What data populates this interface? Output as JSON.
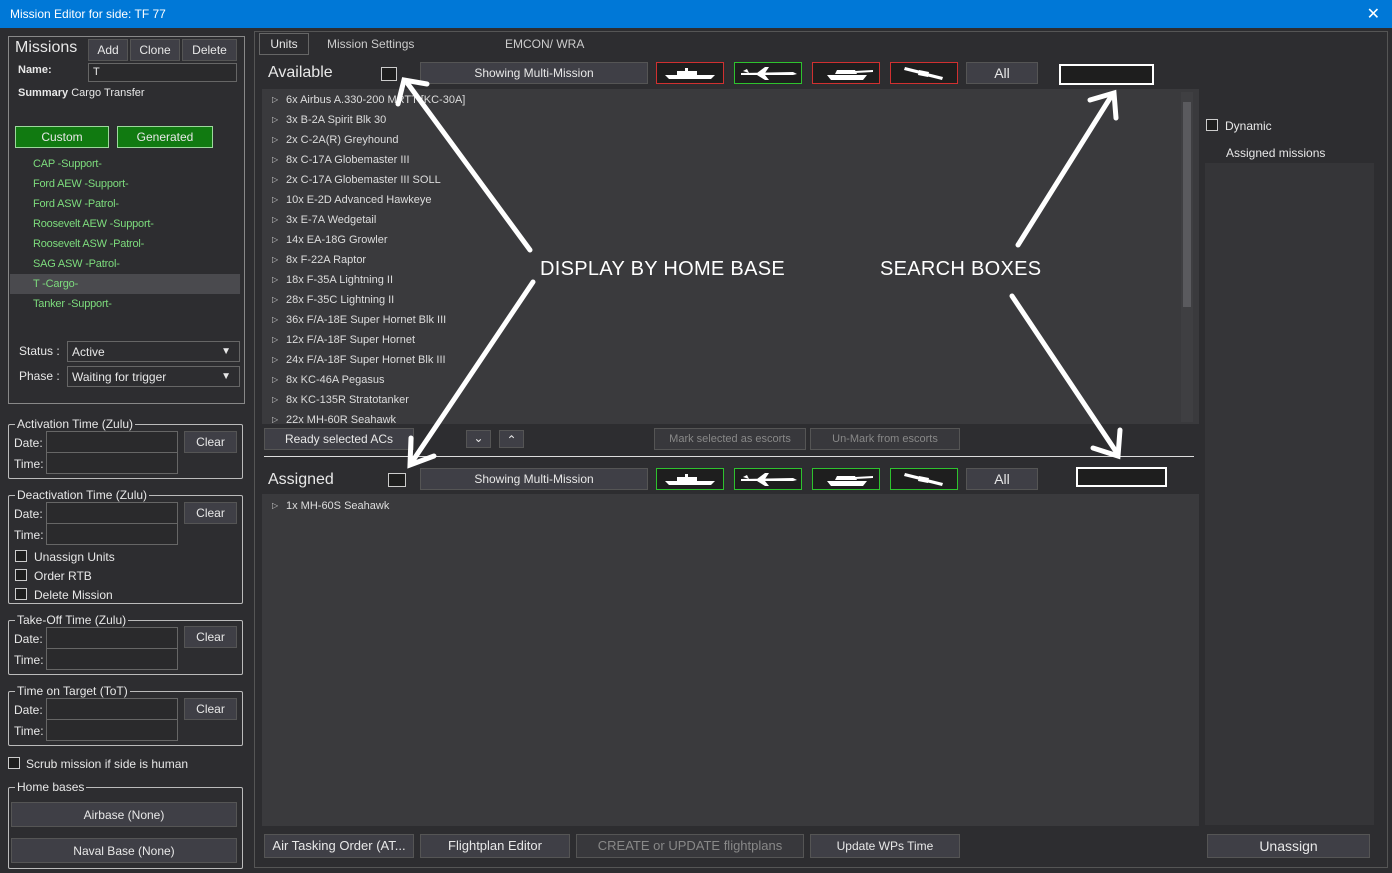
{
  "window": {
    "title": "Mission Editor for side: TF 77",
    "close": "✕"
  },
  "missions": {
    "heading": "Missions",
    "add": "Add",
    "clone": "Clone",
    "delete": "Delete",
    "name_label": "Name:",
    "name_value": "T",
    "summary_label": "Summary",
    "summary_value": "Cargo Transfer",
    "custom": "Custom",
    "generated": "Generated",
    "items": [
      "CAP -Support-",
      "Ford AEW -Support-",
      "Ford ASW  -Patrol-",
      "Roosevelt AEW -Support-",
      "Roosevelt ASW -Patrol-",
      "SAG ASW  -Patrol-",
      "T -Cargo-",
      "Tanker -Support-"
    ],
    "selected_index": 6,
    "status_label": "Status :",
    "status_value": "Active",
    "phase_label": "Phase :",
    "phase_value": "Waiting for trigger"
  },
  "times": {
    "activation": "Activation Time (Zulu)",
    "deactivation": "Deactivation Time (Zulu)",
    "takeoff": "Take-Off Time (Zulu)",
    "tot": "Time on Target (ToT)",
    "date": "Date:",
    "time": "Time:",
    "clear": "Clear",
    "unassign_units": "Unassign Units",
    "order_rtb": "Order RTB",
    "delete_mission": "Delete Mission"
  },
  "scrub": "Scrub mission if side is human",
  "home_bases": {
    "legend": "Home bases",
    "airbase": "Airbase (None)",
    "naval": "Naval Base (None)"
  },
  "tabs": [
    "Units",
    "Mission Settings",
    "EMCON/ WRA"
  ],
  "available": {
    "label": "Available",
    "showing": "Showing Multi-Mission",
    "all": "All",
    "units": [
      "6x Airbus A.330-200 MRTT [KC-30A]",
      "3x B-2A Spirit Blk 30",
      "2x C-2A(R) Greyhound",
      "8x C-17A Globemaster III",
      "2x C-17A Globemaster III SOLL",
      "10x E-2D Advanced Hawkeye",
      "3x E-7A Wedgetail",
      "14x EA-18G Growler",
      "8x F-22A Raptor",
      "18x F-35A Lightning II",
      "28x F-35C Lightning II",
      "36x F/A-18E Super Hornet Blk III",
      "12x F/A-18F Super Hornet",
      "24x F/A-18F Super Hornet Blk III",
      "8x KC-46A Pegasus",
      "8x KC-135R Stratotanker",
      "22x MH-60R Seahawk"
    ]
  },
  "middle": {
    "ready": "Ready selected ACs",
    "mark": "Mark selected as escorts",
    "unmark": "Un-Mark from escorts"
  },
  "assigned": {
    "label": "Assigned",
    "showing": "Showing Multi-Mission",
    "all": "All",
    "units": [
      "1x MH-60S Seahawk"
    ]
  },
  "bottom": {
    "ato": "Air Tasking Order (AT...",
    "flightplan": "Flightplan Editor",
    "create": "CREATE or UPDATE flightplans",
    "update_wps": "Update WPs Time"
  },
  "right": {
    "dynamic": "Dynamic",
    "assigned_missions": "Assigned missions",
    "unassign": "Unassign"
  },
  "annotations": {
    "home_base": "DISPLAY BY HOME BASE",
    "search": "SEARCH BOXES"
  },
  "icons": {
    "ship": "ship-icon",
    "aircraft": "aircraft-icon",
    "tank": "tank-icon",
    "satellite": "satellite-icon"
  },
  "colors": {
    "titlebar": "#0078d7",
    "mission_green": "#7ddc7d",
    "filter_green": "#2ec22e",
    "filter_red": "#d03030"
  }
}
